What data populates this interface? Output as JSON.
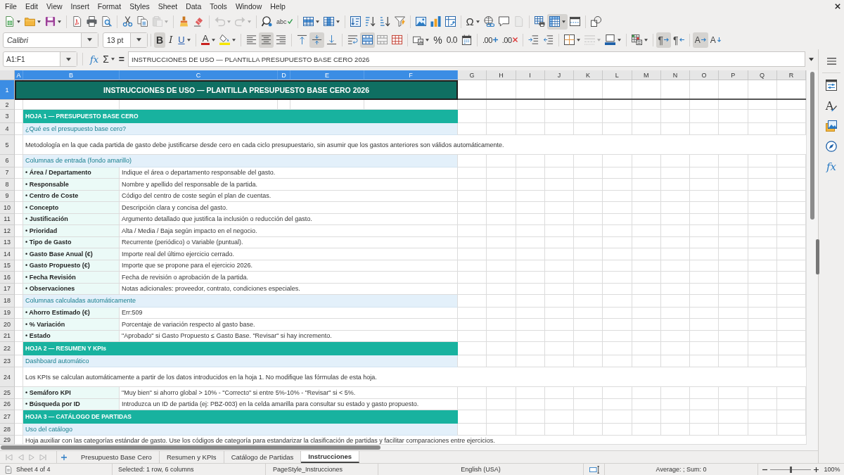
{
  "menu_bar": [
    "File",
    "Edit",
    "View",
    "Insert",
    "Format",
    "Styles",
    "Sheet",
    "Data",
    "Tools",
    "Window",
    "Help"
  ],
  "standard_toolbar": {
    "paste": {
      "disabled": true
    },
    "undo": {
      "disabled": true
    },
    "redo": {
      "disabled": true
    },
    "spelling_glyph": "abc",
    "special_character_glyph": "Ω",
    "headers_footers": {
      "disabled": true
    },
    "freeze_panes": {
      "on": true
    }
  },
  "formatting_toolbar": {
    "font_name": "Calibri",
    "font_size": "13 pt",
    "text_styles": [
      {
        "glyph": "B",
        "on": true
      },
      {
        "glyph": "I",
        "on": false
      },
      {
        "glyph": "U",
        "on": false
      }
    ],
    "font_color_glyph": "A",
    "horizontal_align": [
      {
        "selected": false
      },
      {
        "selected": true
      },
      {
        "selected": false
      }
    ],
    "vertical_align": [
      {
        "selected": false
      },
      {
        "selected": true
      },
      {
        "selected": false
      }
    ],
    "merge_and_center": {
      "on": true
    },
    "percent_glyph": "%",
    "number_glyph": "0.0",
    "add_decimal_glyph": ".00",
    "delete_decimal_glyph": ".00",
    "border_style": {
      "disabled": true
    },
    "paragraph_direction": [
      {
        "glyph": "¶",
        "selected": true
      },
      {
        "glyph": "¶",
        "selected": false
      }
    ],
    "text_orientation": [
      {
        "glyph": "A",
        "selected": true
      },
      {
        "glyph": "A",
        "selected": false
      }
    ]
  },
  "name_box": "A1:F1",
  "formula_bar": {
    "function_wizard_glyph": "fx",
    "sum_glyph": "Σ",
    "formula_glyph": "=",
    "content": "INSTRUCCIONES DE USO — PLANTILLA PRESUPUESTO BASE CERO 2026"
  },
  "columns": [
    {
      "label": "A",
      "selected": true
    },
    {
      "label": "B",
      "selected": true
    },
    {
      "label": "C",
      "selected": true
    },
    {
      "label": "D",
      "selected": true
    },
    {
      "label": "E",
      "selected": true
    },
    {
      "label": "F",
      "selected": true
    },
    {
      "label": "G",
      "selected": false
    },
    {
      "label": "H",
      "selected": false
    },
    {
      "label": "I",
      "selected": false
    },
    {
      "label": "J",
      "selected": false
    },
    {
      "label": "K",
      "selected": false
    },
    {
      "label": "L",
      "selected": false
    },
    {
      "label": "M",
      "selected": false
    },
    {
      "label": "N",
      "selected": false
    },
    {
      "label": "O",
      "selected": false
    },
    {
      "label": "P",
      "selected": false
    },
    {
      "label": "Q",
      "selected": false
    },
    {
      "label": "R",
      "selected": false
    }
  ],
  "rows": [
    {
      "number": "1",
      "selected": true,
      "kind": "title",
      "text": "INSTRUCCIONES DE USO — PLANTILLA PRESUPUESTO BASE CERO 2026"
    },
    {
      "number": "2",
      "selected": false,
      "kind": "blank"
    },
    {
      "number": "3",
      "selected": false,
      "kind": "section",
      "text": "HOJA 1 — PRESUPUESTO BASE CERO"
    },
    {
      "number": "4",
      "selected": false,
      "kind": "subsection",
      "text": "¿Qué es el presupuesto base cero?"
    },
    {
      "number": "5",
      "selected": false,
      "kind": "paragraph",
      "text": "Metodología en la que cada partida de gasto debe justificarse desde cero en cada ciclo presupuestario, sin asumir que los gastos anteriores son válidos automáticamente."
    },
    {
      "number": "6",
      "selected": false,
      "kind": "subsection",
      "text": "Columnas de entrada (fondo amarillo)"
    },
    {
      "number": "7",
      "selected": false,
      "kind": "item",
      "label": "• Área / Departamento",
      "description": "Indique el área o departamento responsable del gasto."
    },
    {
      "number": "8",
      "selected": false,
      "kind": "item",
      "label": "• Responsable",
      "description": "Nombre y apellido del responsable de la partida."
    },
    {
      "number": "9",
      "selected": false,
      "kind": "item",
      "label": "• Centro de Coste",
      "description": "Código del centro de coste según el plan de cuentas."
    },
    {
      "number": "10",
      "selected": false,
      "kind": "item",
      "label": "• Concepto",
      "description": "Descripción clara y concisa del gasto."
    },
    {
      "number": "11",
      "selected": false,
      "kind": "item",
      "label": "• Justificación",
      "description": "Argumento detallado que justifica la inclusión o reducción del gasto."
    },
    {
      "number": "12",
      "selected": false,
      "kind": "item",
      "label": "• Prioridad",
      "description": "Alta / Media / Baja según impacto en el negocio."
    },
    {
      "number": "13",
      "selected": false,
      "kind": "item",
      "label": "• Tipo de Gasto",
      "description": "Recurrente (periódico) o Variable (puntual)."
    },
    {
      "number": "14",
      "selected": false,
      "kind": "item",
      "label": "• Gasto Base Anual (€)",
      "description": "Importe real del último ejercicio cerrado."
    },
    {
      "number": "15",
      "selected": false,
      "kind": "item",
      "label": "• Gasto Propuesto (€)",
      "description": "Importe que se propone para el ejercicio 2026."
    },
    {
      "number": "16",
      "selected": false,
      "kind": "item",
      "label": "• Fecha Revisión",
      "description": "Fecha de revisión o aprobación de la partida."
    },
    {
      "number": "17",
      "selected": false,
      "kind": "item",
      "label": "• Observaciones",
      "description": "Notas adicionales: proveedor, contrato, condiciones especiales."
    },
    {
      "number": "18",
      "selected": false,
      "kind": "subsection",
      "text": "Columnas calculadas automáticamente"
    },
    {
      "number": "19",
      "selected": false,
      "kind": "item",
      "label": "• Ahorro Estimado (€)",
      "description": "Err:509"
    },
    {
      "number": "20",
      "selected": false,
      "kind": "item",
      "label": "• % Variación",
      "description": "Porcentaje de variación respecto al gasto base."
    },
    {
      "number": "21",
      "selected": false,
      "kind": "item",
      "label": "• Estado",
      "description": "\"Aprobado\" si Gasto Propuesto ≤ Gasto Base. \"Revisar\" si hay incremento."
    },
    {
      "number": "22",
      "selected": false,
      "kind": "section",
      "text": "HOJA 2 — RESUMEN Y KPIs"
    },
    {
      "number": "23",
      "selected": false,
      "kind": "subsection",
      "text": "Dashboard automático"
    },
    {
      "number": "24",
      "selected": false,
      "kind": "paragraph",
      "text": "Los KPIs se calculan automáticamente a partir de los datos introducidos en la hoja 1. No modifique las fórmulas de esta hoja."
    },
    {
      "number": "25",
      "selected": false,
      "kind": "item",
      "label": "• Semáforo KPI",
      "description": "\"Muy bien\" si ahorro global > 10% - \"Correcto\" si entre 5%-10% - \"Revisar\" si < 5%."
    },
    {
      "number": "26",
      "selected": false,
      "kind": "item",
      "label": "• Búsqueda por ID",
      "description": "Introduzca un ID de partida (ej: PBZ-003) en la celda amarilla para consultar su estado y gasto propuesto."
    },
    {
      "number": "27",
      "selected": false,
      "kind": "section",
      "text": "HOJA 3 — CATÁLOGO DE PARTIDAS"
    },
    {
      "number": "28",
      "selected": false,
      "kind": "subsection",
      "text": "Uso del catálogo"
    },
    {
      "number": "29",
      "selected": false,
      "kind": "paragraph",
      "text": "Hoja auxiliar con las categorías estándar de gasto. Use los códigos de categoría para estandarizar la clasificación de partidas y facilitar comparaciones entre ejercicios."
    }
  ],
  "sidebar": {
    "styles_glyph": "A",
    "functions_glyph": "fx"
  },
  "sheet_tabs": [
    {
      "label": "Presupuesto Base Cero",
      "selected": false
    },
    {
      "label": "Resumen y KPIs",
      "selected": false
    },
    {
      "label": "Catálogo de Partidas",
      "selected": false
    },
    {
      "label": "Instrucciones",
      "selected": true
    }
  ],
  "status_bar": {
    "sheet": "Sheet 4 of 4",
    "selection": "Selected: 1 row, 6 columns",
    "page_style": "PageStyle_Instrucciones",
    "language": "English (USA)",
    "statistics": "Average: ; Sum: 0",
    "zoom": {
      "level": 0.5
    },
    "zoom_percent": "100%"
  }
}
